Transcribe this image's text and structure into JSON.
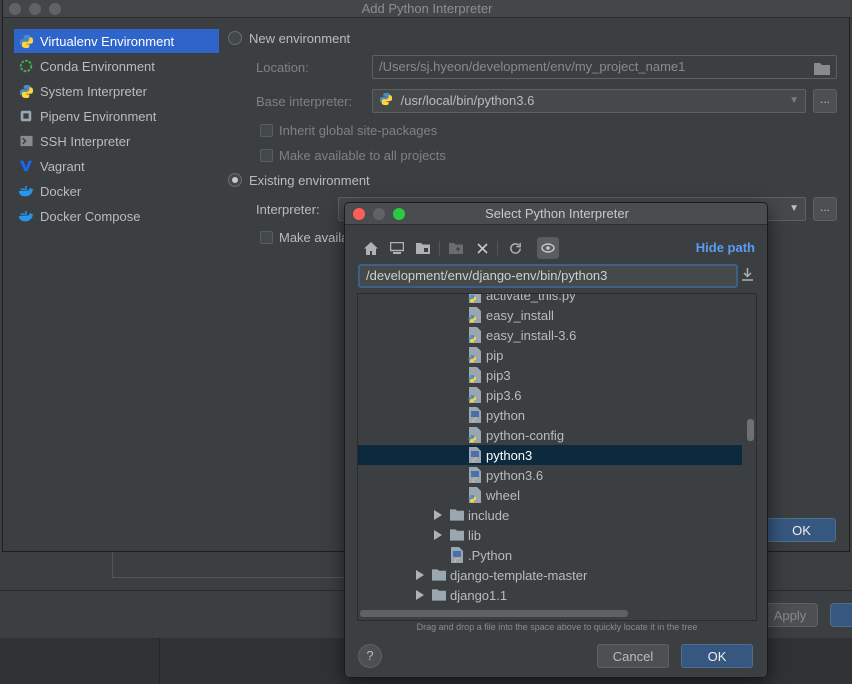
{
  "main_dialog": {
    "title": "Add Python Interpreter",
    "sidebar": {
      "items": [
        {
          "label": "Virtualenv Environment",
          "icon": "python-virtualenv-icon",
          "selected": true
        },
        {
          "label": "Conda Environment",
          "icon": "conda-icon"
        },
        {
          "label": "System Interpreter",
          "icon": "python-icon"
        },
        {
          "label": "Pipenv Environment",
          "icon": "pipenv-icon"
        },
        {
          "label": "SSH Interpreter",
          "icon": "ssh-icon"
        },
        {
          "label": "Vagrant",
          "icon": "vagrant-icon"
        },
        {
          "label": "Docker",
          "icon": "docker-icon"
        },
        {
          "label": "Docker Compose",
          "icon": "docker-compose-icon"
        }
      ]
    },
    "new_env": {
      "label": "New environment",
      "location_label": "Location:",
      "location_value": "/Users/sj.hyeon/development/env/my_project_name1",
      "base_label": "Base interpreter:",
      "base_value": "/usr/local/bin/python3.6",
      "inherit_label": "Inherit global site-packages",
      "available_label": "Make available to all projects"
    },
    "existing_env": {
      "label": "Existing environment",
      "interpreter_label": "Interpreter:",
      "make_available_label": "Make availa",
      "selected": true
    },
    "browse_label": "...",
    "ok_label": "OK"
  },
  "background": {
    "apply_label": "Apply"
  },
  "select_dialog": {
    "title": "Select Python Interpreter",
    "hide_path_label": "Hide path",
    "path_value": "/development/env/django-env/bin/python3",
    "tree": [
      {
        "label": "activate_this.py",
        "type": "py-file",
        "indent": 2
      },
      {
        "label": "easy_install",
        "type": "py-file",
        "indent": 2
      },
      {
        "label": "easy_install-3.6",
        "type": "py-file",
        "indent": 2
      },
      {
        "label": "pip",
        "type": "py-file",
        "indent": 2
      },
      {
        "label": "pip3",
        "type": "py-file",
        "indent": 2
      },
      {
        "label": "pip3.6",
        "type": "py-file",
        "indent": 2
      },
      {
        "label": "python",
        "type": "python-exec",
        "indent": 2
      },
      {
        "label": "python-config",
        "type": "py-file",
        "indent": 2
      },
      {
        "label": "python3",
        "type": "python-exec",
        "indent": 2,
        "selected": true
      },
      {
        "label": "python3.6",
        "type": "python-exec",
        "indent": 2
      },
      {
        "label": "wheel",
        "type": "py-file",
        "indent": 2
      },
      {
        "label": "include",
        "type": "folder",
        "indent": 1,
        "collapsed": true
      },
      {
        "label": "lib",
        "type": "folder",
        "indent": 1,
        "collapsed": true
      },
      {
        "label": ".Python",
        "type": "python-exec",
        "indent": 1
      },
      {
        "label": "django-template-master",
        "type": "folder",
        "indent": 0,
        "collapsed": true
      },
      {
        "label": "django1.1",
        "type": "folder",
        "indent": 0,
        "collapsed": true
      }
    ],
    "hint": "Drag and drop a file into the space above to quickly locate it in the tree",
    "help_label": "?",
    "cancel_label": "Cancel",
    "ok_label": "OK"
  },
  "colors": {
    "accent": "#2f65ca",
    "link": "#589df6",
    "ok_button": "#365880",
    "tree_selection": "#0d293e",
    "background": "#3c3f41"
  }
}
